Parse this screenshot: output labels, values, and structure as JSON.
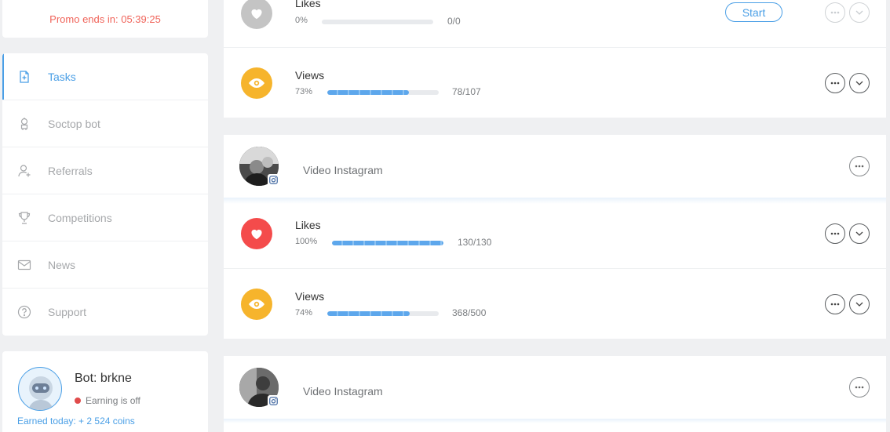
{
  "promo": {
    "text": "Promo ends in: 05:39:25"
  },
  "menu": {
    "items": [
      {
        "label": "Tasks",
        "icon": "tasks-icon",
        "active": true
      },
      {
        "label": "Soctop bot",
        "icon": "robot-icon"
      },
      {
        "label": "Referrals",
        "icon": "add-user-icon"
      },
      {
        "label": "Competitions",
        "icon": "trophy-icon"
      },
      {
        "label": "News",
        "icon": "envelope-icon"
      },
      {
        "label": "Support",
        "icon": "help-icon"
      }
    ]
  },
  "bot": {
    "name": "Bot: brkne",
    "status": "Earning is off",
    "earned": "Earned today: + 2 524 coins"
  },
  "post1": {
    "likes": {
      "name": "Likes",
      "pct": "0%",
      "count": "0/0",
      "progress": 0,
      "start_label": "Start"
    },
    "views": {
      "name": "Views",
      "pct": "73%",
      "count": "78/107",
      "progress": 0.73
    }
  },
  "post2": {
    "title": "Video Instagram",
    "likes": {
      "name": "Likes",
      "pct": "100%",
      "count": "130/130",
      "progress": 1.0
    },
    "views": {
      "name": "Views",
      "pct": "74%",
      "count": "368/500",
      "progress": 0.74
    }
  },
  "post3": {
    "title": "Video Instagram"
  },
  "colors": {
    "accent": "#4a9fe6",
    "likes_active": "#f44b4b",
    "likes_inactive": "#c4c4c4",
    "views": "#f6b42c",
    "promo": "#f0645a"
  }
}
